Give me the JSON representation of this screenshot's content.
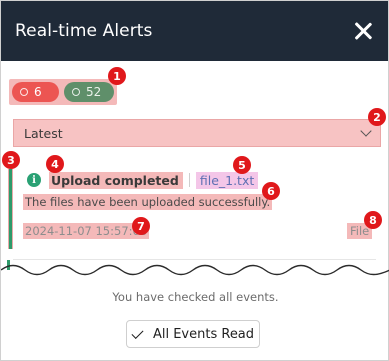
{
  "header": {
    "title": "Real-time Alerts"
  },
  "summary": {
    "error_count": "6",
    "success_count": "52"
  },
  "filter": {
    "selected": "Latest"
  },
  "event": {
    "title": "Upload completed",
    "file": "file_1.txt",
    "description": "The files have been uploaded successfully.",
    "timestamp": "2024-11-07 15:57:03",
    "category": "File"
  },
  "footer": {
    "note": "You have checked all events.",
    "all_read_label": "All Events Read"
  },
  "markers": [
    "1",
    "2",
    "3",
    "4",
    "5",
    "6",
    "7",
    "8"
  ],
  "colors": {
    "header_bg": "#1f2a38",
    "accent_green": "#2aa174",
    "error_red": "#ec5552",
    "marker_red": "#e0181b"
  }
}
